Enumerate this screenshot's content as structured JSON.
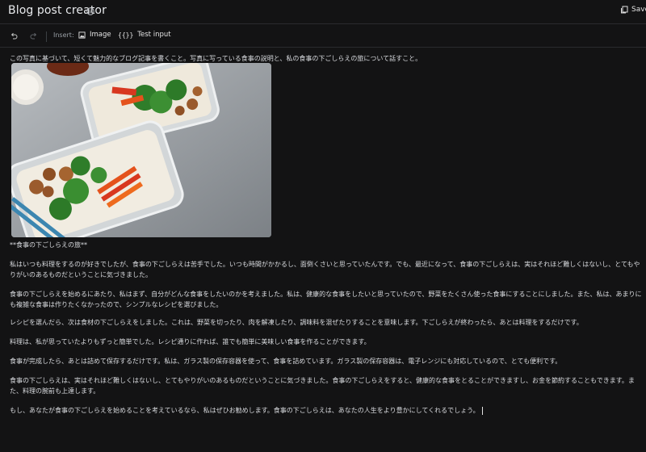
{
  "header": {
    "title": "Blog post creator",
    "info_icon": "info-circle-icon",
    "save_label": "Save",
    "save_icon": "copy-icon"
  },
  "toolbar": {
    "undo_icon": "undo-icon",
    "redo_icon": "redo-icon",
    "insert_label": "Insert:",
    "image_label": "Image",
    "image_icon": "image-icon",
    "test_input_label": "Test input",
    "test_input_icon": "curly-braces-icon"
  },
  "prompt": {
    "instruction": "この写真に基づいて、短くて魅力的なブログ記事を書くこと。写真に写っている食事の説明と、私の食事の下ごしらえの旅について話すこと。",
    "heading": "**食事の下ごしらえの旅**",
    "paragraphs": [
      "私はいつも料理をするのが好きでしたが、食事の下ごしらえは苦手でした。いつも時間がかかるし、面倒くさいと思っていたんです。でも、最近になって、食事の下ごしらえは、実はそれほど難しくはないし、とてもやりがいのあるものだということに気づきました。",
      "食事の下ごしらえを始めるにあたり、私はまず、自分がどんな食事をしたいのかを考えました。私は、健康的な食事をしたいと思っていたので、野菜をたくさん使った食事にすることにしました。また、私は、あまりにも複雑な食事は作りたくなかったので、シンプルなレシピを選びました。",
      "レシピを選んだら、次は食材の下ごしらえをしました。これは、野菜を切ったり、肉を解凍したり、調味料を混ぜたりすることを意味します。下ごしらえが終わったら、あとは料理をするだけです。",
      "料理は、私が思っていたよりもずっと簡単でした。レシピ通りに作れば、誰でも簡単に美味しい食事を作ることができます。",
      "食事が完成したら、あとは詰めて保存するだけです。私は、ガラス製の保存容器を使って、食事を詰めています。ガラス製の保存容器は、電子レンジにも対応しているので、とても便利です。",
      "食事の下ごしらえは、実はそれほど難しくはないし、とてもやりがいのあるものだということに気づきました。食事の下ごしらえをすると、健康的な食事をとることができますし、お金を節約することもできます。また、料理の腕前も上達します。",
      "もし、あなたが食事の下ごしらえを始めることを考えているなら、私はぜひお勧めします。食事の下ごしらえは、あなたの人生をより豊かにしてくれるでしょう。"
    ]
  },
  "colors": {
    "background": "#131314",
    "text": "#dadce0",
    "border": "#2a2b2e"
  }
}
